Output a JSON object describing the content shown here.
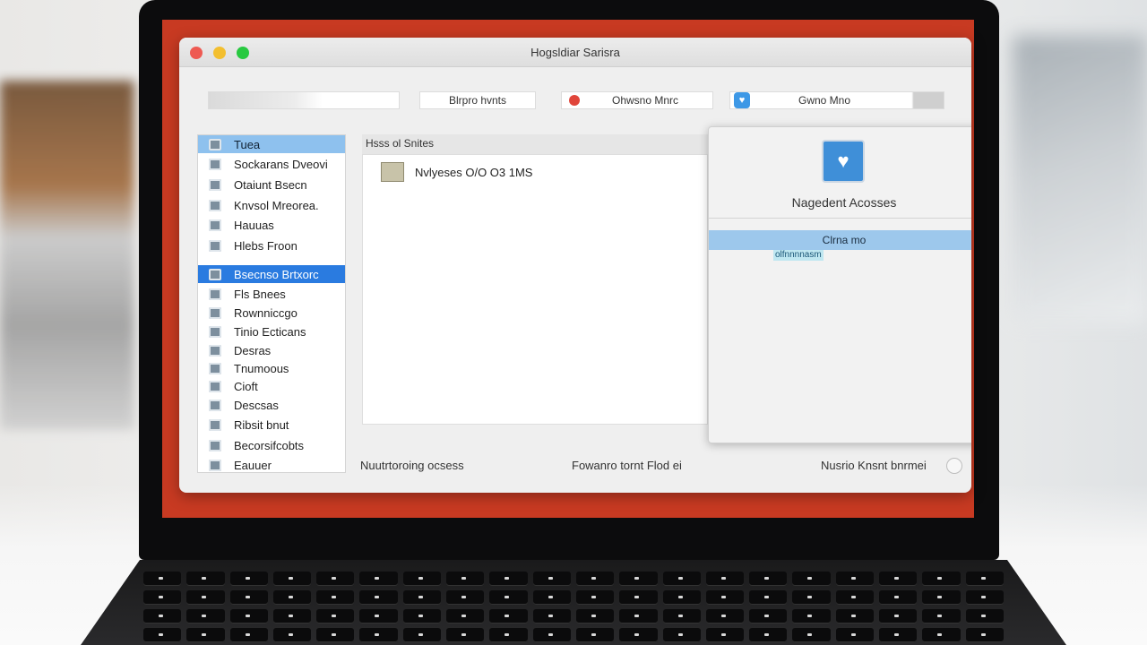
{
  "window": {
    "title": "Hogsldiar Sarisra"
  },
  "toolbar": {
    "seg2": "Blrpro hvnts",
    "seg3": "Ohwsno Mnrc",
    "seg4": "Gwno Mno"
  },
  "sidebar": {
    "items": [
      {
        "label": "Tuea",
        "state": "selected-light"
      },
      {
        "label": "Sockarans Dveovi"
      },
      {
        "label": "Otaiunt Bsecn"
      },
      {
        "label": "Knvsol Mreorea."
      },
      {
        "label": "Hauuas"
      },
      {
        "label": "Hlebs Froon"
      },
      {
        "label": "Bsecnso Brtxorc",
        "state": "selected"
      },
      {
        "label": "Fls Bnees"
      },
      {
        "label": "Rownniccgo"
      },
      {
        "label": "Tinio Ecticans"
      },
      {
        "label": "Desras"
      },
      {
        "label": "Tnumoous"
      },
      {
        "label": "Cioft"
      },
      {
        "label": "Descsas"
      },
      {
        "label": "Ribsit bnut"
      },
      {
        "label": "Becorsifcobts"
      },
      {
        "label": "Eauuer"
      }
    ]
  },
  "center": {
    "header": "Hsss ol Snites",
    "file": "Nvlyeses O/O O3 1MS"
  },
  "popover": {
    "title": "Nagedent Acosses",
    "selected": "Clrna   mo",
    "sub": "olfnnnnasm"
  },
  "footer": {
    "left": "Nuutrtoroing ocsess",
    "middle": "Fowanro tornt Flod ei",
    "right": "Nusrio Knsnt bnrmei"
  },
  "colors": {
    "selection_blue": "#2a7be0",
    "light_selection": "#8ec1ee",
    "screen_red": "#c83a22"
  }
}
